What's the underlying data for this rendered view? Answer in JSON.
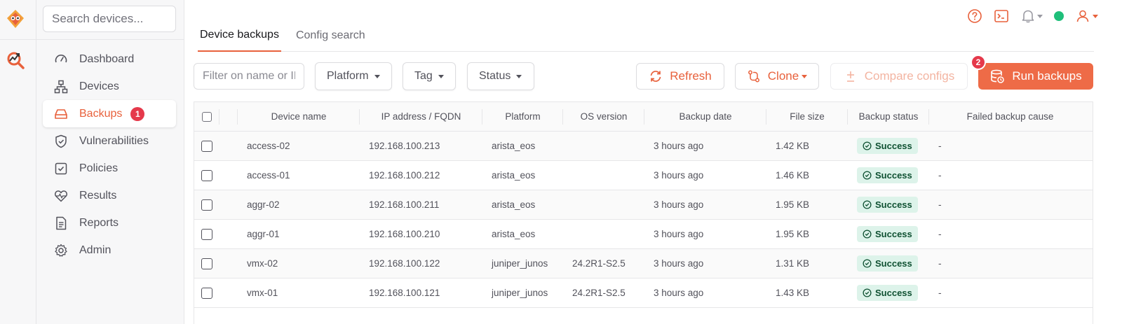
{
  "sidebar": {
    "search_placeholder": "Search devices...",
    "items": [
      {
        "label": "Dashboard",
        "icon": "gauge-icon"
      },
      {
        "label": "Devices",
        "icon": "network-icon"
      },
      {
        "label": "Backups",
        "icon": "drive-icon",
        "badge": "1"
      },
      {
        "label": "Vulnerabilities",
        "icon": "shield-check-icon"
      },
      {
        "label": "Policies",
        "icon": "checkbox-icon"
      },
      {
        "label": "Results",
        "icon": "heart-pulse-icon"
      },
      {
        "label": "Reports",
        "icon": "document-icon"
      },
      {
        "label": "Admin",
        "icon": "gear-icon"
      }
    ]
  },
  "tabs": [
    "Device backups",
    "Config search"
  ],
  "toolbar": {
    "filter_placeholder": "Filter on name or IP",
    "platform_label": "Platform",
    "tag_label": "Tag",
    "status_label": "Status",
    "refresh_label": "Refresh",
    "clone_label": "Clone",
    "compare_label": "Compare configs",
    "run_label": "Run backups",
    "run_badge": "2"
  },
  "table": {
    "columns": [
      "Device name",
      "IP address / FQDN",
      "Platform",
      "OS version",
      "Backup date",
      "File size",
      "Backup status",
      "Failed backup cause"
    ],
    "rows": [
      {
        "name": "access-02",
        "ip": "192.168.100.213",
        "platform": "arista_eos",
        "os": "",
        "date": "3 hours ago",
        "size": "1.42 KB",
        "status": "Success",
        "cause": "-"
      },
      {
        "name": "access-01",
        "ip": "192.168.100.212",
        "platform": "arista_eos",
        "os": "",
        "date": "3 hours ago",
        "size": "1.46 KB",
        "status": "Success",
        "cause": "-"
      },
      {
        "name": "aggr-02",
        "ip": "192.168.100.211",
        "platform": "arista_eos",
        "os": "",
        "date": "3 hours ago",
        "size": "1.95 KB",
        "status": "Success",
        "cause": "-"
      },
      {
        "name": "aggr-01",
        "ip": "192.168.100.210",
        "platform": "arista_eos",
        "os": "",
        "date": "3 hours ago",
        "size": "1.95 KB",
        "status": "Success",
        "cause": "-"
      },
      {
        "name": "vmx-02",
        "ip": "192.168.100.122",
        "platform": "juniper_junos",
        "os": "24.2R1-S2.5",
        "date": "3 hours ago",
        "size": "1.31 KB",
        "status": "Success",
        "cause": "-"
      },
      {
        "name": "vmx-01",
        "ip": "192.168.100.121",
        "platform": "juniper_junos",
        "os": "24.2R1-S2.5",
        "date": "3 hours ago",
        "size": "1.43 KB",
        "status": "Success",
        "cause": "-"
      }
    ]
  },
  "colors": {
    "accent": "#e8613c",
    "primary_button": "#ee6b47",
    "badge": "#e5394b",
    "online": "#1fbf7a",
    "success_bg": "#ddf3ea"
  }
}
